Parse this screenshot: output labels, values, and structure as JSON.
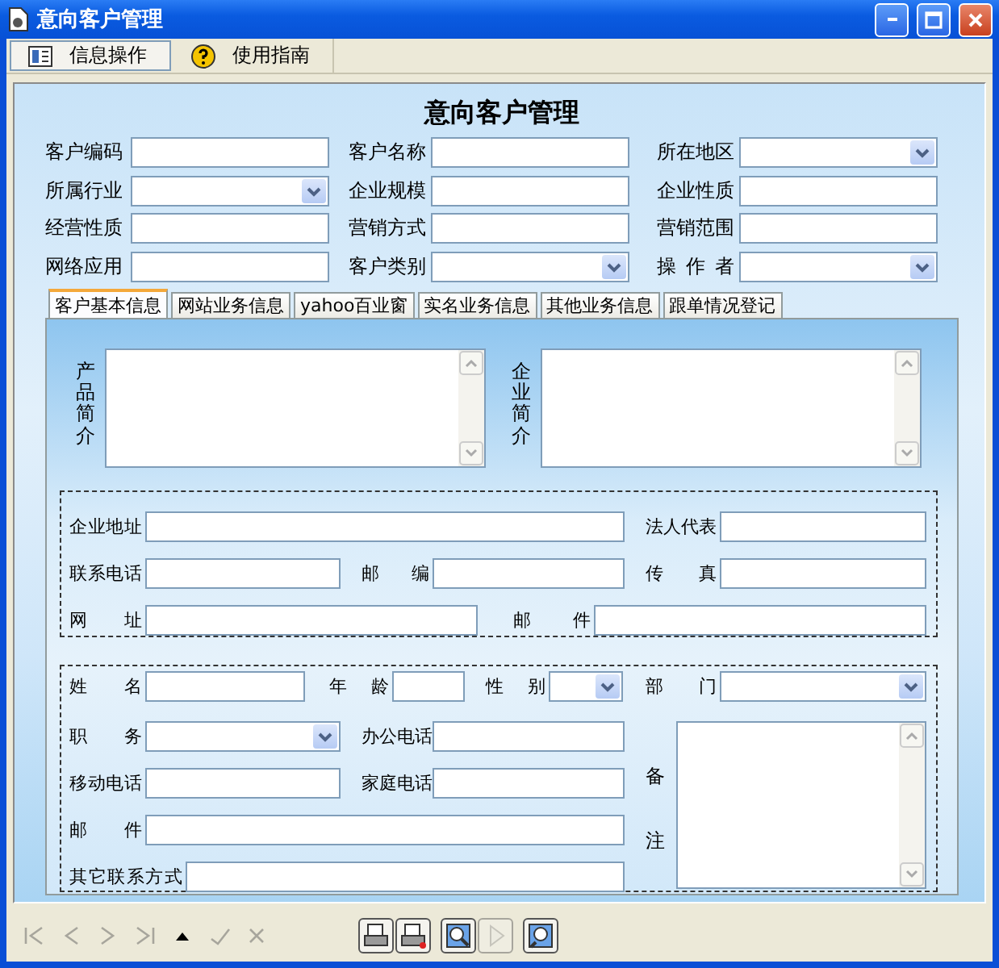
{
  "window": {
    "title": "意向客户管理"
  },
  "toolbar": [
    {
      "label": "信息操作",
      "kind": "info",
      "selected": true
    },
    {
      "label": "使用指南",
      "kind": "help",
      "selected": false
    }
  ],
  "form": {
    "title": "意向客户管理",
    "fields": [
      {
        "label": "客户编码",
        "kind": "text"
      },
      {
        "label": "客户名称",
        "kind": "text"
      },
      {
        "label": "所在地区",
        "kind": "select"
      },
      {
        "label": "所属行业",
        "kind": "select"
      },
      {
        "label": "企业规模",
        "kind": "text"
      },
      {
        "label": "企业性质",
        "kind": "text"
      },
      {
        "label": "经营性质",
        "kind": "text"
      },
      {
        "label": "营销方式",
        "kind": "text"
      },
      {
        "label": "营销范围",
        "kind": "text"
      },
      {
        "label": "网络应用",
        "kind": "text"
      },
      {
        "label": "客户类别",
        "kind": "select"
      },
      {
        "label": "操 作 者",
        "kind": "select"
      }
    ]
  },
  "tabs": [
    {
      "label": "客户基本信息",
      "selected": true
    },
    {
      "label": "网站业务信息",
      "selected": false
    },
    {
      "label": "yahoo百业窗",
      "selected": false
    },
    {
      "label": "实名业务信息",
      "selected": false
    },
    {
      "label": "其他业务信息",
      "selected": false
    },
    {
      "label": "跟单情况登记",
      "selected": false
    }
  ],
  "descriptions": [
    {
      "label": "产品简介"
    },
    {
      "label": "企业简介"
    }
  ],
  "company": {
    "fields": [
      {
        "label": "企业地址",
        "kind": "text"
      },
      {
        "label": "法人代表",
        "kind": "text"
      },
      {
        "label": "联系电话",
        "kind": "text"
      },
      {
        "label": "邮 编",
        "kind": "text"
      },
      {
        "label": "传 真",
        "kind": "text"
      },
      {
        "label": "网 址",
        "kind": "text"
      },
      {
        "label": "邮 件",
        "kind": "text"
      }
    ]
  },
  "contact": {
    "top_row": [
      {
        "label": "姓 名",
        "kind": "text"
      },
      {
        "label": "年 龄",
        "kind": "text"
      },
      {
        "label": "性 别",
        "kind": "select"
      },
      {
        "label": "部 门",
        "kind": "select"
      }
    ],
    "rows": [
      [
        {
          "label": "职 务",
          "kind": "select"
        },
        {
          "label": "办公电话",
          "kind": "text"
        }
      ],
      [
        {
          "label": "移动电话",
          "kind": "text"
        },
        {
          "label": "家庭电话",
          "kind": "text"
        }
      ],
      [
        {
          "label": "邮 件",
          "kind": "text"
        }
      ],
      [
        {
          "label": "其它联系方式",
          "kind": "text"
        }
      ]
    ],
    "remarks": {
      "label": "备注"
    }
  },
  "nav": [
    {
      "kind": "first",
      "disabled": true
    },
    {
      "kind": "prev",
      "disabled": true
    },
    {
      "kind": "next",
      "disabled": true
    },
    {
      "kind": "last",
      "disabled": true
    },
    {
      "kind": "add",
      "disabled": false
    },
    {
      "kind": "save",
      "disabled": true
    },
    {
      "kind": "cancel",
      "disabled": true
    },
    {
      "kind": "print",
      "disabled": false
    },
    {
      "kind": "print-setup",
      "disabled": false
    },
    {
      "kind": "preview",
      "disabled": false
    },
    {
      "kind": "play",
      "disabled": true
    },
    {
      "kind": "search",
      "disabled": false
    }
  ]
}
